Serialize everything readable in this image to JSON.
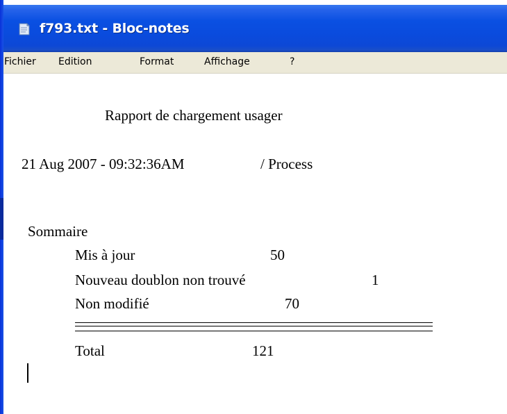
{
  "window": {
    "title": "f793.txt - Bloc-notes",
    "icon": "notepad-icon"
  },
  "menu": {
    "items": [
      "Fichier",
      "Edition",
      "Format",
      "Affichage",
      "?"
    ]
  },
  "document": {
    "heading": "Rapport de chargement usager",
    "datetime": "21 Aug 2007 - 09:32:36AM",
    "process": "/ Process",
    "summary_label": "Sommaire",
    "rows": [
      {
        "label": "Mis à jour",
        "value": "50"
      },
      {
        "label": "Nouveau doublon non trouvé",
        "value": "1"
      },
      {
        "label": "Non modifié",
        "value": "70"
      }
    ],
    "total": {
      "label": "Total",
      "value": "121"
    }
  }
}
